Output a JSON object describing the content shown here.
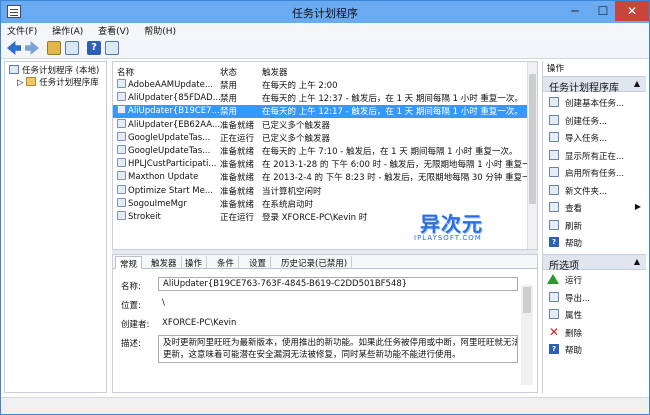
{
  "window": {
    "title": "任务计划程序",
    "min": "─",
    "max": "☐",
    "close": "✕"
  },
  "menu": [
    "文件(F)",
    "操作(A)",
    "查看(V)",
    "帮助(H)"
  ],
  "tree": {
    "root": "任务计划程序 (本地)",
    "child": "任务计划程序库"
  },
  "columns": {
    "name": "名称",
    "status": "状态",
    "trigger": "触发器"
  },
  "tasks": [
    {
      "name": "AdobeAAMUpdate...",
      "status": "禁用",
      "trigger": "在每天的 上午 2:00"
    },
    {
      "name": "AliUpdater{85FDAD...",
      "status": "禁用",
      "trigger": "在每天的 上午 12:37 - 触发后，在 1 天 期间每隔 1 小时 重复一次。"
    },
    {
      "name": "AliUpdater{B19CE7...",
      "status": "禁用",
      "trigger": "在每天的 上午 12:17 - 触发后，在 1 天 期间每隔 1 小时 重复一次。"
    },
    {
      "name": "AliUpdater{EB62AA...",
      "status": "准备就绪",
      "trigger": "已定义多个触发器"
    },
    {
      "name": "GoogleUpdateTas...",
      "status": "正在运行",
      "trigger": "已定义多个触发器"
    },
    {
      "name": "GoogleUpdateTas...",
      "status": "准备就绪",
      "trigger": "在每天的 上午 7:10 - 触发后，在 1 天 期间每隔 1 小时 重复一次。"
    },
    {
      "name": "HPLJCustParticipati...",
      "status": "准备就绪",
      "trigger": "在 2013-1-28 的 下午 6:00 时 - 触发后，无限期地每隔 1 小时 重复一次。"
    },
    {
      "name": "Maxthon Update",
      "status": "准备就绪",
      "trigger": "在 2013-2-4 的 下午 8:23 时 - 触发后，无限期地每隔 30 分钟 重复一次。"
    },
    {
      "name": "Optimize Start Me...",
      "status": "准备就绪",
      "trigger": "当计算机空闲时"
    },
    {
      "name": "SogouImeMgr",
      "status": "准备就绪",
      "trigger": "在系统启动时"
    },
    {
      "name": "Strokeit",
      "status": "正在运行",
      "trigger": "登录 XFORCE-PC\\Kevin 时"
    }
  ],
  "selected_index": 2,
  "tabs": [
    "常规",
    "触发器",
    "操作",
    "条件",
    "设置",
    "历史记录(已禁用)"
  ],
  "detail": {
    "name_label": "名称:",
    "name_value": "AliUpdater{B19CE763-763F-4845-B619-C2DD501BF548}",
    "location_label": "位置:",
    "location_value": "\\",
    "author_label": "创建者:",
    "author_value": "XFORCE-PC\\Kevin",
    "desc_label": "描述:",
    "desc_line1": "及时更新阿里旺旺为最新版本，使用推出的新功能。如果此任务被停用或中断，阿里旺旺就无法",
    "desc_line2": "更新，这意味着可能潜在安全漏洞无法被修复，同时某些新功能不能进行使用。"
  },
  "actions": {
    "header": "操作",
    "group1": "任务计划程序库",
    "items1": [
      "创建基本任务...",
      "创建任务...",
      "导入任务...",
      "显示所有正在...",
      "启用所有任务...",
      "新文件夹...",
      "查看",
      "刷新",
      "帮助"
    ],
    "group2": "所选项",
    "items2": [
      "运行",
      "导出...",
      "属性",
      "删除",
      "帮助"
    ]
  },
  "logo": {
    "big": "异次元",
    "small": "IPLAYSOFT.COM"
  }
}
